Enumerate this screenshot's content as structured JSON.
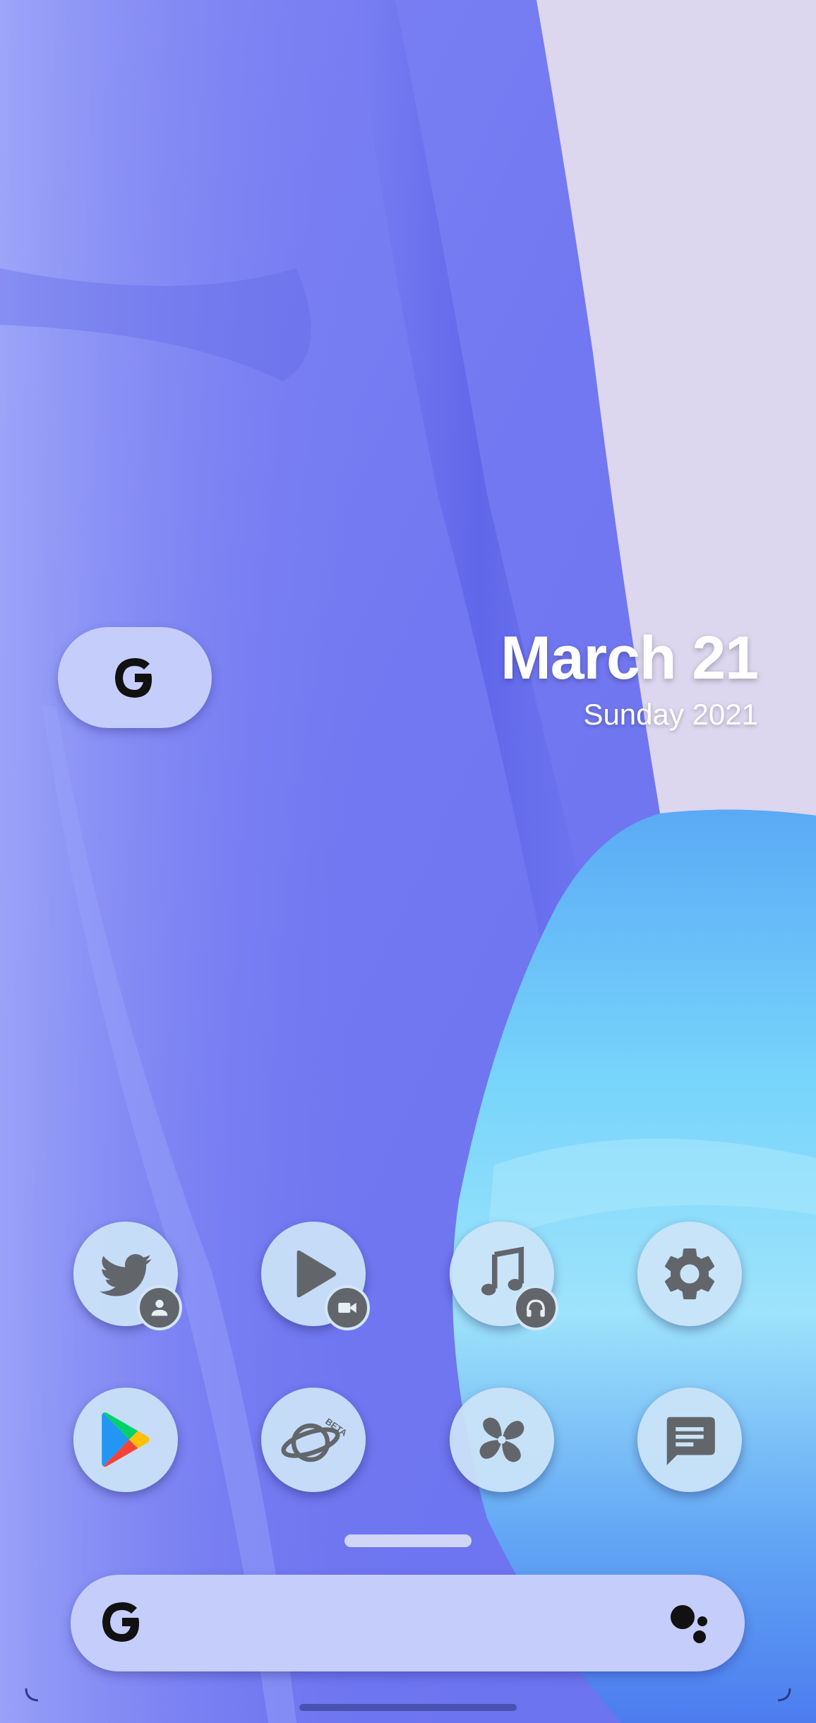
{
  "home": {
    "date_main": "March 21",
    "date_sub": "Sunday 2021"
  },
  "dock_row_1": [
    {
      "name": "twitter-app",
      "icon": "twitter-bird-icon",
      "badge": "work-profile-icon"
    },
    {
      "name": "video-player-app",
      "icon": "play-icon",
      "badge": "video-camera-icon"
    },
    {
      "name": "music-app",
      "icon": "music-note-icon",
      "badge": "headphones-icon"
    },
    {
      "name": "settings-app",
      "icon": "gear-icon"
    }
  ],
  "dock_row_2": [
    {
      "name": "play-store-app",
      "icon": "play-store-icon"
    },
    {
      "name": "browser-beta-app",
      "icon": "planet-icon",
      "label": "BETA"
    },
    {
      "name": "pinwheel-app",
      "icon": "pinwheel-icon"
    },
    {
      "name": "messages-app",
      "icon": "message-icon"
    }
  ],
  "colors": {
    "wallpaper_blue": "#6a74ef",
    "wallpaper_lavender": "#dcd6ee",
    "wallpaper_cyan": "#79d3fb",
    "icon_bg": "#cce4f7",
    "icon_fg": "#62666b",
    "pill_bg": "#c5cdfa"
  }
}
